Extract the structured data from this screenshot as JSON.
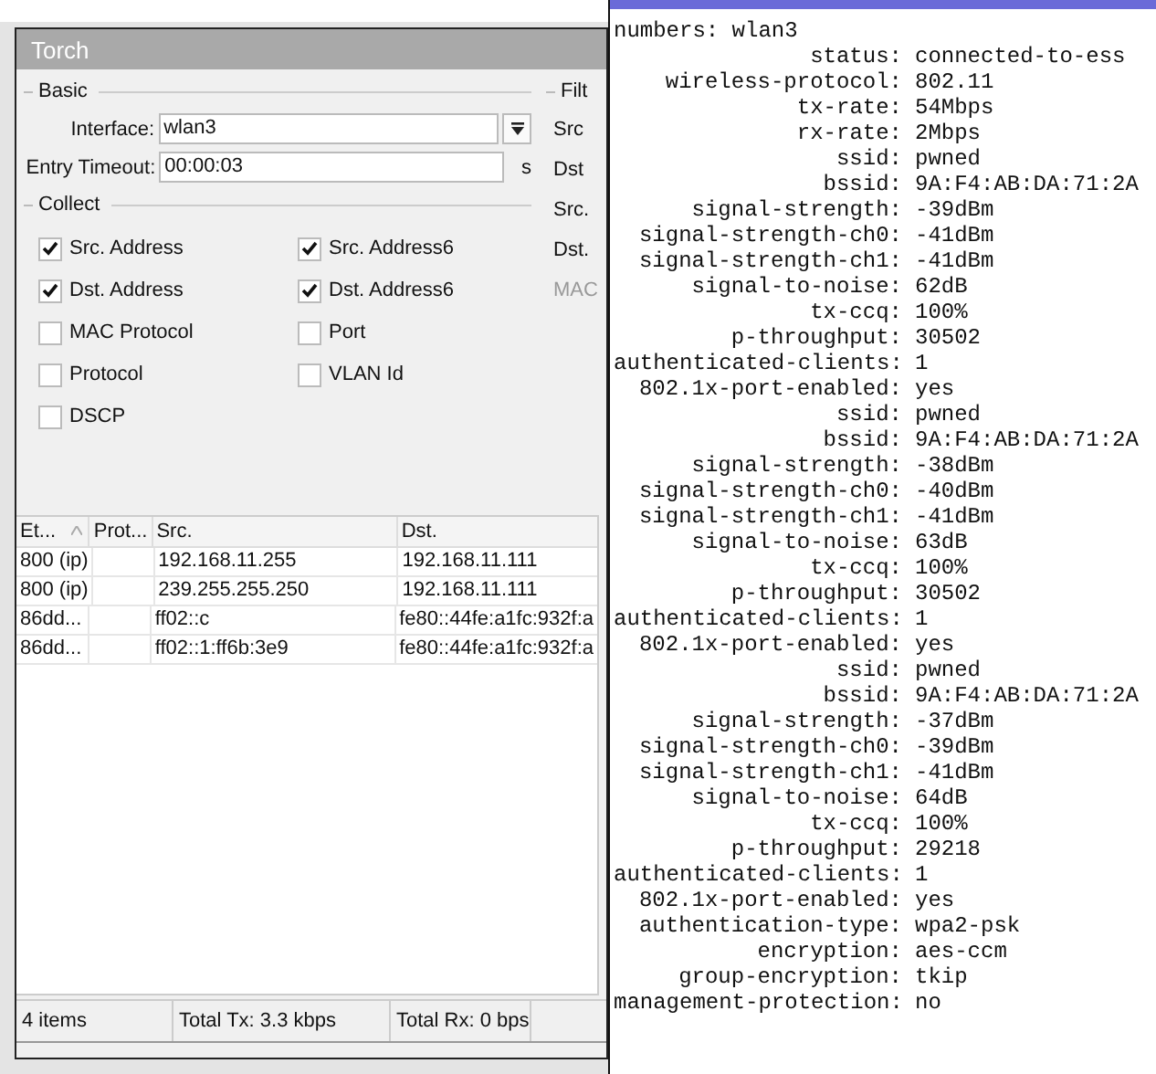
{
  "torch": {
    "title": "Torch",
    "basic": {
      "legend": "Basic",
      "interface_label": "Interface:",
      "interface_value": "wlan3",
      "timeout_label": "Entry Timeout:",
      "timeout_value": "00:00:03",
      "timeout_unit": "s"
    },
    "collect": {
      "legend": "Collect",
      "options": [
        {
          "label": "Src. Address",
          "checked": true
        },
        {
          "label": "Src. Address6",
          "checked": true
        },
        {
          "label": "Dst. Address",
          "checked": true
        },
        {
          "label": "Dst. Address6",
          "checked": true
        },
        {
          "label": "MAC Protocol",
          "checked": false
        },
        {
          "label": "Port",
          "checked": false
        },
        {
          "label": "Protocol",
          "checked": false
        },
        {
          "label": "VLAN Id",
          "checked": false
        },
        {
          "label": "DSCP",
          "checked": false
        }
      ]
    },
    "filter": {
      "legend": "Filt",
      "labels": [
        {
          "text": "Src",
          "disabled": false
        },
        {
          "text": "Dst",
          "disabled": false
        },
        {
          "text": "Src.",
          "disabled": false
        },
        {
          "text": "Dst.",
          "disabled": false
        },
        {
          "text": "MAC",
          "disabled": true
        }
      ]
    },
    "table": {
      "columns": [
        "Et...",
        "Prot...",
        "Src.",
        "Dst."
      ],
      "rows": [
        [
          "800 (ip)",
          "",
          "192.168.11.255",
          "192.168.11.111"
        ],
        [
          "800 (ip)",
          "",
          "239.255.255.250",
          "192.168.11.111"
        ],
        [
          "86dd...",
          "",
          "ff02::c",
          "fe80::44fe:a1fc:932f:a"
        ],
        [
          "86dd...",
          "",
          "ff02::1:ff6b:3e9",
          "fe80::44fe:a1fc:932f:a"
        ]
      ]
    },
    "status_bar": [
      "4 items",
      "Total Tx: 3.3 kbps",
      "Total Rx: 0 bps"
    ]
  },
  "terminal": {
    "first_line": "numbers: wlan3",
    "lines": [
      {
        "key": "status:",
        "value": "connected-to-ess"
      },
      {
        "key": "wireless-protocol:",
        "value": "802.11"
      },
      {
        "key": "tx-rate:",
        "value": "54Mbps"
      },
      {
        "key": "rx-rate:",
        "value": "2Mbps"
      },
      {
        "key": "ssid:",
        "value": "pwned"
      },
      {
        "key": "bssid:",
        "value": "9A:F4:AB:DA:71:2A"
      },
      {
        "key": "signal-strength:",
        "value": "-39dBm"
      },
      {
        "key": "signal-strength-ch0:",
        "value": "-41dBm"
      },
      {
        "key": "signal-strength-ch1:",
        "value": "-41dBm"
      },
      {
        "key": "signal-to-noise:",
        "value": "62dB"
      },
      {
        "key": "tx-ccq:",
        "value": "100%"
      },
      {
        "key": "p-throughput:",
        "value": "30502"
      },
      {
        "key": "authenticated-clients:",
        "value": "1"
      },
      {
        "key": "802.1x-port-enabled:",
        "value": "yes"
      },
      {
        "key": "ssid:",
        "value": "pwned"
      },
      {
        "key": "bssid:",
        "value": "9A:F4:AB:DA:71:2A"
      },
      {
        "key": "signal-strength:",
        "value": "-38dBm"
      },
      {
        "key": "signal-strength-ch0:",
        "value": "-40dBm"
      },
      {
        "key": "signal-strength-ch1:",
        "value": "-41dBm"
      },
      {
        "key": "signal-to-noise:",
        "value": "63dB"
      },
      {
        "key": "tx-ccq:",
        "value": "100%"
      },
      {
        "key": "p-throughput:",
        "value": "30502"
      },
      {
        "key": "authenticated-clients:",
        "value": "1"
      },
      {
        "key": "802.1x-port-enabled:",
        "value": "yes"
      },
      {
        "key": "ssid:",
        "value": "pwned"
      },
      {
        "key": "bssid:",
        "value": "9A:F4:AB:DA:71:2A"
      },
      {
        "key": "signal-strength:",
        "value": "-37dBm"
      },
      {
        "key": "signal-strength-ch0:",
        "value": "-39dBm"
      },
      {
        "key": "signal-strength-ch1:",
        "value": "-41dBm"
      },
      {
        "key": "signal-to-noise:",
        "value": "64dB"
      },
      {
        "key": "tx-ccq:",
        "value": "100%"
      },
      {
        "key": "p-throughput:",
        "value": "29218"
      },
      {
        "key": "authenticated-clients:",
        "value": "1"
      },
      {
        "key": "802.1x-port-enabled:",
        "value": "yes"
      },
      {
        "key": "authentication-type:",
        "value": "wpa2-psk"
      },
      {
        "key": "encryption:",
        "value": "aes-ccm"
      },
      {
        "key": "group-encryption:",
        "value": "tkip"
      },
      {
        "key": "management-protection:",
        "value": "no"
      }
    ]
  }
}
